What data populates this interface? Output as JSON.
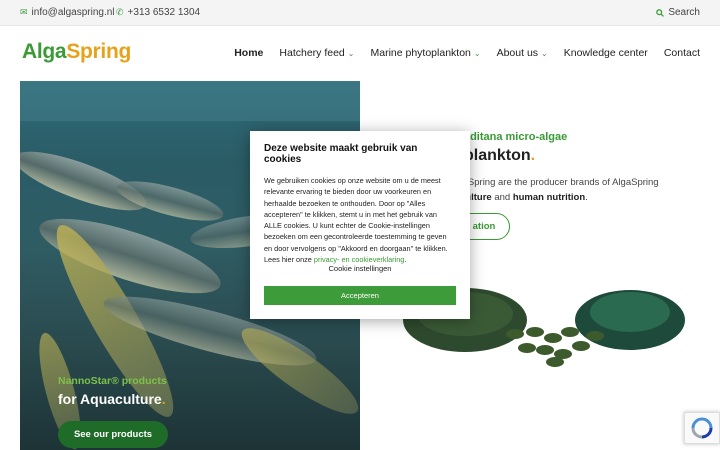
{
  "topbar": {
    "email": "info@algaspring.nl",
    "phone": "+313 6532 1304",
    "search": "Search"
  },
  "header": {
    "logo_part1": "Alga",
    "logo_part2": "Spring",
    "nav": [
      {
        "label": "Home",
        "active": true,
        "dropdown": false
      },
      {
        "label": "Hatchery feed",
        "dropdown": true
      },
      {
        "label": "Marine phytoplankton",
        "dropdown": true
      },
      {
        "label": "About us",
        "dropdown": true
      },
      {
        "label": "Knowledge center",
        "dropdown": false
      },
      {
        "label": "Contact",
        "dropdown": false
      }
    ]
  },
  "hero": {
    "subtitle": "NannoStar® products",
    "title": "for Aquaculture",
    "title_dot": ".",
    "button": "See our products"
  },
  "right": {
    "subtitle": "is gaditana micro-algae",
    "title": "ytoplankton",
    "title_dot": ".",
    "text_a": "triSpring are the producer brands of AlgaSpring",
    "text_b1": "culture",
    "text_b2": " and ",
    "text_b3": "human nutrition",
    "text_b4": ".",
    "button": "ation"
  },
  "cookie": {
    "title": "Deze website maakt gebruik van cookies",
    "body": "We gebruiken cookies op onze website om u de meest relevante ervaring te bieden door uw voorkeuren en herhaalde bezoeken te onthouden. Door op \"Alles accepteren\" te klikken, stemt u in met het gebruik van ALLE cookies. U kunt echter de Cookie-instellingen bezoeken om een gecontroleerde toestemming te geven en door vervolgens op \"Akkoord en doorgaan\" te klikken. Lees hier onze ",
    "link": "privacy- en cookieverklaring",
    "body_end": ".",
    "settings": "Cookie instellingen",
    "accept": "Accepteren"
  },
  "colors": {
    "brand_green": "#3a9a35",
    "brand_orange": "#e6a21b",
    "button_dark_green": "#1f6b28"
  }
}
